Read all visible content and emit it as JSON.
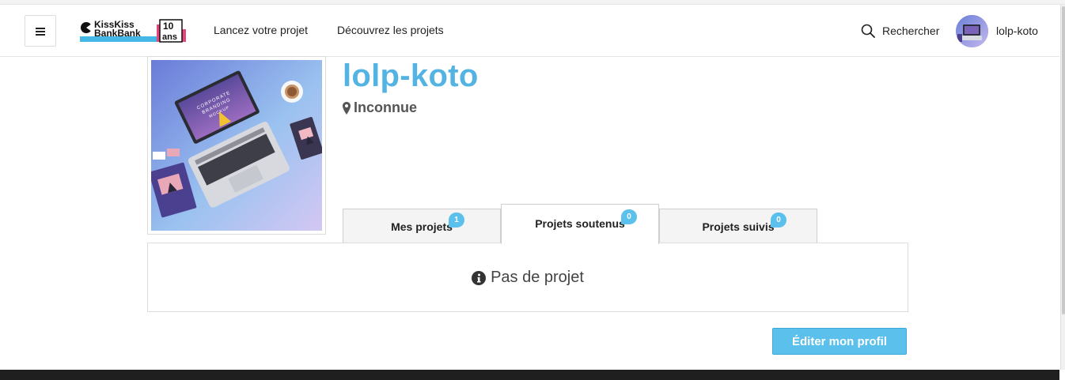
{
  "header": {
    "menu_icon": "hamburger-icon",
    "logo": {
      "line1": "KissKiss",
      "line2": "BankBank",
      "anniv_number": "10",
      "anniv_word": "ans"
    },
    "nav": [
      {
        "label": "Lancez votre projet"
      },
      {
        "label": "Découvrez les projets"
      }
    ],
    "search": {
      "icon": "search-icon",
      "label": "Rechercher"
    },
    "user": {
      "name": "lolp-koto"
    }
  },
  "profile": {
    "name": "lolp-koto",
    "location": "Inconnue",
    "image_text": {
      "l1": "CORPORATE",
      "l2": "BRANDING",
      "l3": "MOCKUP"
    }
  },
  "tabs": [
    {
      "label": "Mes projets",
      "count": "1",
      "active": false
    },
    {
      "label": "Projets soutenus",
      "count": "0",
      "active": true
    },
    {
      "label": "Projets suivis",
      "count": "0",
      "active": false
    }
  ],
  "panel": {
    "empty_message": "Pas de projet",
    "icon": "info-icon"
  },
  "actions": {
    "edit_label": "Éditer mon profil"
  },
  "colors": {
    "accent": "#5bc0eb",
    "title": "#53b4e3",
    "footer": "#1f1f1f"
  }
}
